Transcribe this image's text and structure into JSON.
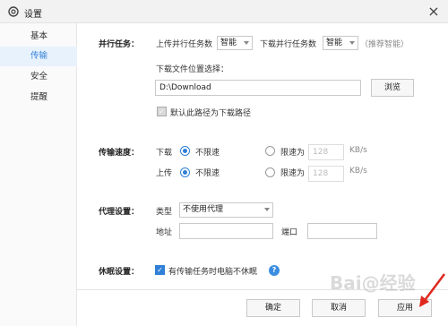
{
  "window": {
    "title": "设置",
    "close_label": "×"
  },
  "sidebar": {
    "items": [
      {
        "label": "基本",
        "active": false
      },
      {
        "label": "传输",
        "active": true
      },
      {
        "label": "安全",
        "active": false
      },
      {
        "label": "提醒",
        "active": false
      }
    ]
  },
  "parallel": {
    "section_label": "并行任务：",
    "upload_label": "上传并行任务数",
    "upload_value": "智能",
    "download_label": "下载并行任务数",
    "download_value": "智能",
    "hint": "（推荐智能）"
  },
  "download_location": {
    "label": "下载文件位置选择：",
    "path": "D:\\Download",
    "browse_label": "浏览",
    "default_checkbox_label": "默认此路径为下载路径",
    "default_checked": true
  },
  "speed": {
    "section_label": "传输速度：",
    "download_label": "下载",
    "upload_label": "上传",
    "unlimited_label": "不限速",
    "limit_label": "限速为",
    "download_limit_value": "128",
    "upload_limit_value": "128",
    "unit": "KB/s",
    "download_mode": "unlimited",
    "upload_mode": "unlimited"
  },
  "proxy": {
    "section_label": "代理设置：",
    "type_label": "类型",
    "type_value": "不使用代理",
    "address_label": "地址",
    "address_value": "",
    "port_label": "端口",
    "port_value": ""
  },
  "sleep": {
    "section_label": "休眠设置：",
    "checkbox_label": "有传输任务时电脑不休眠",
    "checked": true,
    "help_label": "?"
  },
  "footer": {
    "ok_label": "确定",
    "cancel_label": "取消",
    "apply_label": "应用"
  },
  "colors": {
    "accent": "#2f80d6",
    "arrow": "#e0281d"
  },
  "watermark": "Bai@经验"
}
